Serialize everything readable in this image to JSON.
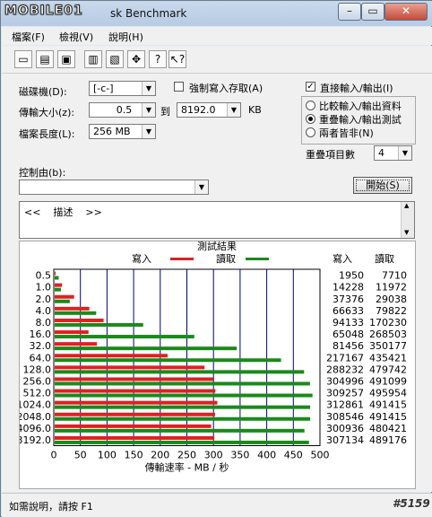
{
  "window": {
    "logo_text": "MOBILE01",
    "title": "sk Benchmark"
  },
  "menu": [
    "檔案(F)",
    "檢視(V)",
    "說明(H)"
  ],
  "toolbar": {
    "icons": [
      "new-file-icon",
      "open-folder-icon",
      "save-icon",
      "print-icon",
      "print-preview-icon",
      "move-icon",
      "help-icon",
      "context-help-icon"
    ],
    "glyphs": [
      "▭",
      "▤",
      "▣",
      "▥",
      "▧",
      "✥",
      "?",
      "↖?"
    ]
  },
  "settings": {
    "drive_label": "磁碟機(D):",
    "drive_value": "[-c-]",
    "transfer_label": "傳輸大小(z):",
    "transfer_from": "0.5",
    "to_label": "到",
    "transfer_to": "8192.0",
    "unit": "KB",
    "file_length_label": "檔案長度(L):",
    "file_length_value": "256 MB",
    "force_write_label": "強制寫入存取(A)",
    "force_write_checked": false,
    "direct_io_label": "直接輸入/輸出(I)",
    "direct_io_checked": true,
    "radio_options": [
      "比較輸入/輸出資料",
      "重疊輸入/輸出測試",
      "兩者皆非(N)"
    ],
    "radio_selected": 1,
    "queue_depth_label": "重疊項目數",
    "queue_depth_value": "4",
    "controlled_by_label": "控制由(b):",
    "controlled_by_value": "",
    "start_button": "開始(S)",
    "description_text": "<<    描述    >>"
  },
  "results": {
    "title": "測試結果",
    "legend_write": "寫入",
    "legend_read": "讀取",
    "col_write": "寫入",
    "col_read": "讀取",
    "write_color": "#e02020",
    "read_color": "#1a8a1a"
  },
  "chart_data": {
    "type": "bar",
    "orientation": "horizontal",
    "categories": [
      "0.5",
      "1.0",
      "2.0",
      "4.0",
      "8.0",
      "16.0",
      "32.0",
      "64.0",
      "128.0",
      "256.0",
      "512.0",
      "1024.0",
      "2048.0",
      "4096.0",
      "3192.0"
    ],
    "series": [
      {
        "name": "寫入",
        "values": [
          1950,
          14228,
          37376,
          66633,
          94133,
          65048,
          81456,
          217167,
          288232,
          304996,
          309257,
          312861,
          308546,
          300936,
          307134
        ]
      },
      {
        "name": "讀取",
        "values": [
          7710,
          11972,
          29038,
          79822,
          170230,
          268503,
          350177,
          435421,
          479742,
          491099,
          495954,
          491415,
          491415,
          480421,
          489176
        ]
      }
    ],
    "xlabel": "傳輸速率 - MB / 秒",
    "xticks": [
      "0",
      "50",
      "100",
      "150",
      "200",
      "250",
      "300",
      "350",
      "400",
      "450",
      "500"
    ],
    "xlim": [
      0,
      500
    ],
    "grid": true
  },
  "status": {
    "text": "如需說明，請按 F1",
    "watermark": "#5159"
  }
}
